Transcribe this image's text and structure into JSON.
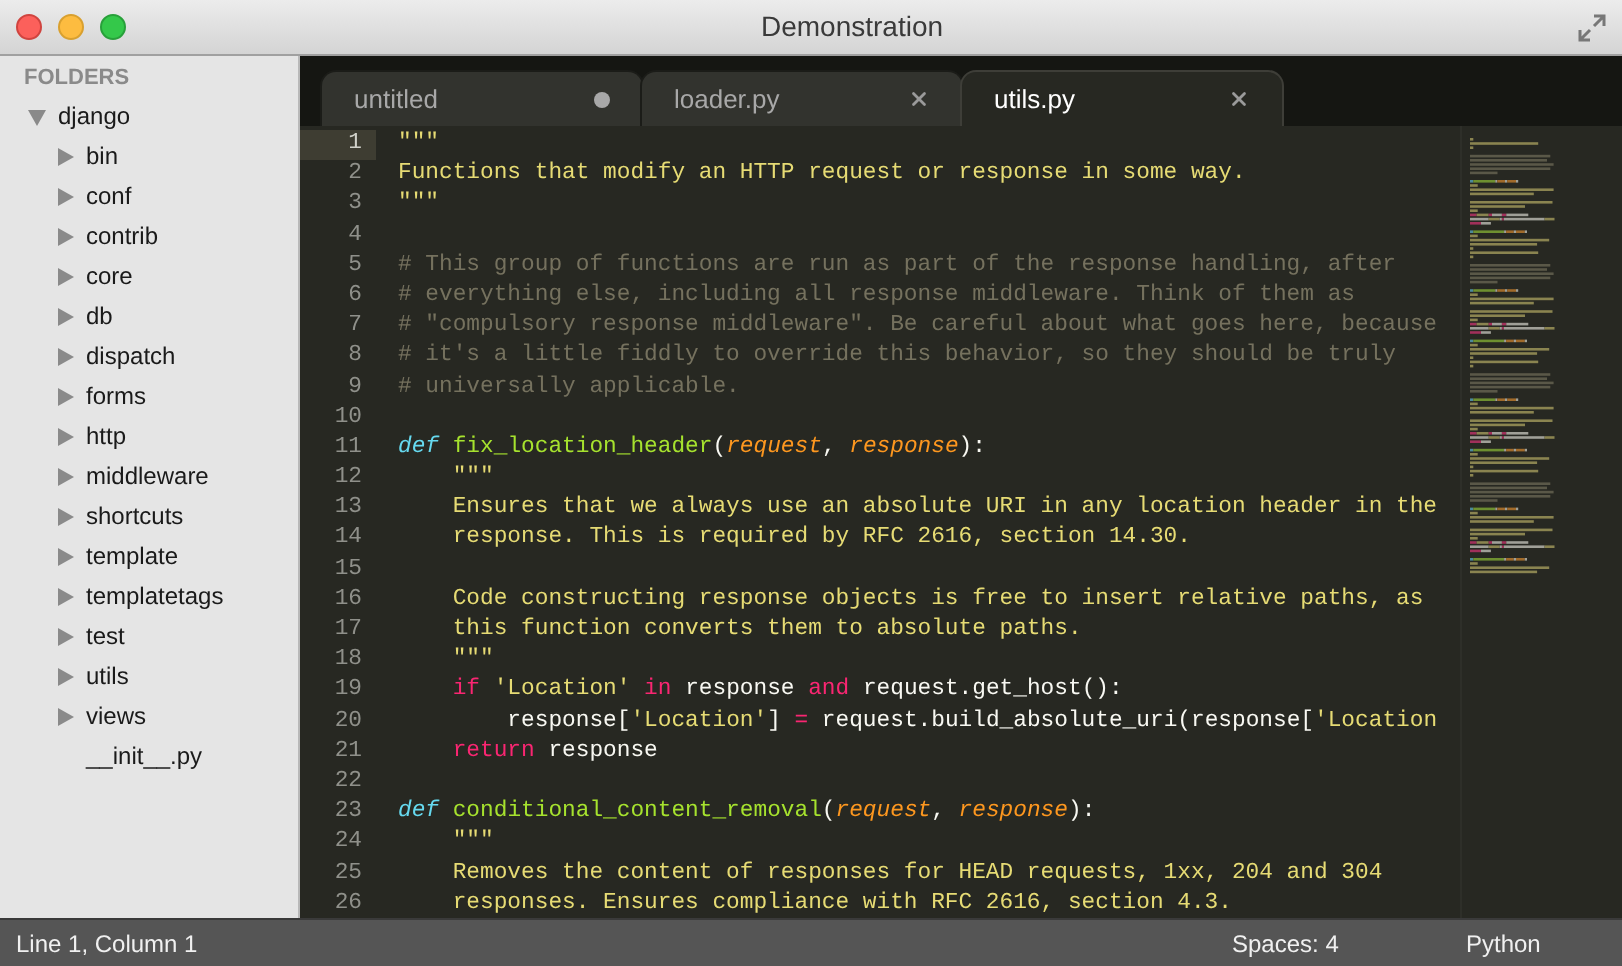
{
  "window": {
    "title": "Demonstration"
  },
  "sidebar": {
    "heading": "FOLDERS",
    "tree": [
      {
        "label": "django",
        "kind": "folder",
        "expanded": true,
        "children": [
          {
            "label": "bin",
            "kind": "folder",
            "expanded": false
          },
          {
            "label": "conf",
            "kind": "folder",
            "expanded": false
          },
          {
            "label": "contrib",
            "kind": "folder",
            "expanded": false
          },
          {
            "label": "core",
            "kind": "folder",
            "expanded": false
          },
          {
            "label": "db",
            "kind": "folder",
            "expanded": false
          },
          {
            "label": "dispatch",
            "kind": "folder",
            "expanded": false
          },
          {
            "label": "forms",
            "kind": "folder",
            "expanded": false
          },
          {
            "label": "http",
            "kind": "folder",
            "expanded": false
          },
          {
            "label": "middleware",
            "kind": "folder",
            "expanded": false
          },
          {
            "label": "shortcuts",
            "kind": "folder",
            "expanded": false
          },
          {
            "label": "template",
            "kind": "folder",
            "expanded": false
          },
          {
            "label": "templatetags",
            "kind": "folder",
            "expanded": false
          },
          {
            "label": "test",
            "kind": "folder",
            "expanded": false
          },
          {
            "label": "utils",
            "kind": "folder",
            "expanded": false
          },
          {
            "label": "views",
            "kind": "folder",
            "expanded": false
          },
          {
            "label": "__init__.py",
            "kind": "file"
          }
        ]
      }
    ]
  },
  "tabs": [
    {
      "label": "untitled",
      "selected": false,
      "dirty": true
    },
    {
      "label": "loader.py",
      "selected": false,
      "dirty": false
    },
    {
      "label": "utils.py",
      "selected": true,
      "dirty": false
    }
  ],
  "editor": {
    "lines": [
      {
        "number": "1",
        "current": true,
        "tokens": [
          {
            "kind": "string",
            "text": "\"\"\""
          }
        ]
      },
      {
        "number": "2",
        "current": false,
        "tokens": [
          {
            "kind": "string",
            "text": "Functions that modify an HTTP request or response in some way."
          }
        ]
      },
      {
        "number": "3",
        "current": false,
        "tokens": [
          {
            "kind": "string",
            "text": "\"\"\""
          }
        ]
      },
      {
        "number": "4",
        "current": false
      },
      {
        "number": "5",
        "current": false,
        "tokens": [
          {
            "kind": "comment",
            "text": "# This group of functions are run as part of the response handling, after"
          }
        ]
      },
      {
        "number": "6",
        "current": false,
        "tokens": [
          {
            "kind": "comment",
            "text": "# everything else, including all response middleware. Think of them as"
          }
        ]
      },
      {
        "number": "7",
        "current": false,
        "tokens": [
          {
            "kind": "comment",
            "text": "# \"compulsory response middleware\". Be careful about what goes here, because"
          }
        ]
      },
      {
        "number": "8",
        "current": false,
        "tokens": [
          {
            "kind": "comment",
            "text": "# it's a little fiddly to override this behavior, so they should be truly"
          }
        ]
      },
      {
        "number": "9",
        "current": false,
        "tokens": [
          {
            "kind": "comment",
            "text": "# universally applicable."
          }
        ]
      },
      {
        "number": "10",
        "current": false
      },
      {
        "number": "11",
        "current": false,
        "tokens": [
          {
            "kind": "storage",
            "text": "def"
          },
          {
            "kind": "function",
            "text": " fix_location_header"
          },
          {
            "kind": "plain",
            "text": "("
          },
          {
            "kind": "param",
            "text": "request"
          },
          {
            "kind": "plain",
            "text": ", "
          },
          {
            "kind": "param",
            "text": "response"
          },
          {
            "kind": "plain",
            "text": "):"
          }
        ]
      },
      {
        "number": "12",
        "current": false,
        "tokens": [
          {
            "kind": "string",
            "text": "    \"\"\""
          }
        ]
      },
      {
        "number": "13",
        "current": false,
        "tokens": [
          {
            "kind": "string",
            "text": "    Ensures that we always use an absolute URI in any location header in the"
          }
        ]
      },
      {
        "number": "14",
        "current": false,
        "tokens": [
          {
            "kind": "string",
            "text": "    response. This is required by RFC 2616, section 14.30."
          }
        ]
      },
      {
        "number": "15",
        "current": false
      },
      {
        "number": "16",
        "current": false,
        "tokens": [
          {
            "kind": "string",
            "text": "    Code constructing response objects is free to insert relative paths, as"
          }
        ]
      },
      {
        "number": "17",
        "current": false,
        "tokens": [
          {
            "kind": "string",
            "text": "    this function converts them to absolute paths."
          }
        ]
      },
      {
        "number": "18",
        "current": false,
        "tokens": [
          {
            "kind": "string",
            "text": "    \"\"\""
          }
        ]
      },
      {
        "number": "19",
        "current": false,
        "tokens": [
          {
            "kind": "keyword",
            "text": "    if"
          },
          {
            "kind": "string",
            "text": " 'Location'"
          },
          {
            "kind": "keyword",
            "text": " in"
          },
          {
            "kind": "plain",
            "text": " response"
          },
          {
            "kind": "keyword",
            "text": " and"
          },
          {
            "kind": "plain",
            "text": " request.get_host():"
          }
        ]
      },
      {
        "number": "20",
        "current": false,
        "tokens": [
          {
            "kind": "plain",
            "text": "        response["
          },
          {
            "kind": "string",
            "text": "'Location'"
          },
          {
            "kind": "plain",
            "text": "] "
          },
          {
            "kind": "keyword",
            "text": "="
          },
          {
            "kind": "plain",
            "text": " request.build_absolute_uri(response["
          },
          {
            "kind": "string",
            "text": "'Location"
          }
        ]
      },
      {
        "number": "21",
        "current": false,
        "tokens": [
          {
            "kind": "keyword",
            "text": "    return"
          },
          {
            "kind": "plain",
            "text": " response"
          }
        ]
      },
      {
        "number": "22",
        "current": false
      },
      {
        "number": "23",
        "current": false,
        "tokens": [
          {
            "kind": "storage",
            "text": "def"
          },
          {
            "kind": "function",
            "text": " conditional_content_removal"
          },
          {
            "kind": "plain",
            "text": "("
          },
          {
            "kind": "param",
            "text": "request"
          },
          {
            "kind": "plain",
            "text": ", "
          },
          {
            "kind": "param",
            "text": "response"
          },
          {
            "kind": "plain",
            "text": "):"
          }
        ]
      },
      {
        "number": "24",
        "current": false,
        "tokens": [
          {
            "kind": "string",
            "text": "    \"\"\""
          }
        ]
      },
      {
        "number": "25",
        "current": false,
        "tokens": [
          {
            "kind": "string",
            "text": "    Removes the content of responses for HEAD requests, 1xx, 204 and 304"
          }
        ]
      },
      {
        "number": "26",
        "current": false,
        "tokens": [
          {
            "kind": "string",
            "text": "    responses. Ensures compliance with RFC 2616, section 4.3."
          }
        ]
      }
    ]
  },
  "status_bar": {
    "position": "Line 1, Column 1",
    "indentation": "Spaces: 4",
    "syntax": "Python"
  }
}
